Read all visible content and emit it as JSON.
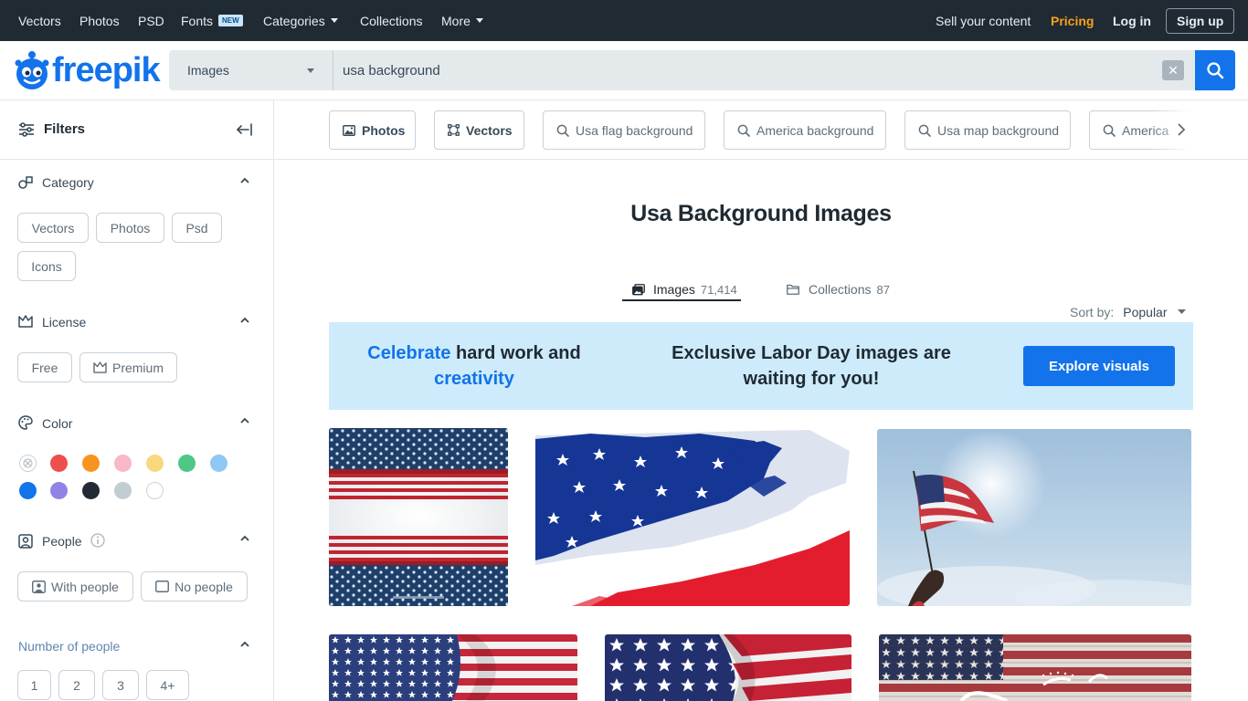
{
  "topnav": {
    "left": [
      {
        "label": "Vectors"
      },
      {
        "label": "Photos"
      },
      {
        "label": "PSD"
      },
      {
        "label": "Fonts",
        "badge": "NEW"
      },
      {
        "label": "Categories",
        "dropdown": true
      },
      {
        "label": "Collections"
      },
      {
        "label": "More",
        "dropdown": true
      }
    ],
    "sell": "Sell your content",
    "pricing": "Pricing",
    "login": "Log in",
    "signup": "Sign up"
  },
  "logo": {
    "text": "freepik"
  },
  "search": {
    "type_selected": "Images",
    "query": "usa background",
    "clear_icon": "close-icon",
    "button_icon": "search-icon"
  },
  "filters": {
    "title": "Filters",
    "category": {
      "title": "Category",
      "options": [
        "Vectors",
        "Photos",
        "Psd",
        "Icons"
      ]
    },
    "license": {
      "title": "License",
      "options": [
        "Free",
        "Premium"
      ]
    },
    "color": {
      "title": "Color",
      "swatches": [
        "none",
        "#ef4e4e",
        "#f7941d",
        "#f9b8c8",
        "#f9d77e",
        "#4cc784",
        "#8ec8f4",
        "#1273eb",
        "#8f83e8",
        "#222b33",
        "#c2ccd3",
        "#ffffff"
      ]
    },
    "people": {
      "title": "People",
      "options": [
        "With people",
        "No people"
      ]
    },
    "number_of_people": {
      "title": "Number of people",
      "options": [
        "1",
        "2",
        "3",
        "4+"
      ]
    }
  },
  "chips": [
    {
      "label": "Photos",
      "icon": "image-icon"
    },
    {
      "label": "Vectors",
      "icon": "vector-icon"
    },
    {
      "label": "Usa flag background",
      "icon": "search-icon"
    },
    {
      "label": "America background",
      "icon": "search-icon"
    },
    {
      "label": "Usa map background",
      "icon": "search-icon"
    },
    {
      "label": "America",
      "icon": "search-icon"
    }
  ],
  "page_title": "Usa Background Images",
  "tabs": [
    {
      "label": "Images",
      "count": "71,414",
      "active": true
    },
    {
      "label": "Collections",
      "count": "87",
      "active": false
    }
  ],
  "sort": {
    "label": "Sort by:",
    "value": "Popular"
  },
  "banner": {
    "left_blue1": "Celebrate",
    "left_dark": "hard work and",
    "left_blue2": "creativity",
    "middle": "Exclusive Labor Day images are waiting for you!",
    "button": "Explore visuals"
  },
  "colors": {
    "brand": "#1273eb",
    "topbar": "#1f2a33",
    "pricing": "#f9a21b",
    "banner": "#cdebfb"
  }
}
